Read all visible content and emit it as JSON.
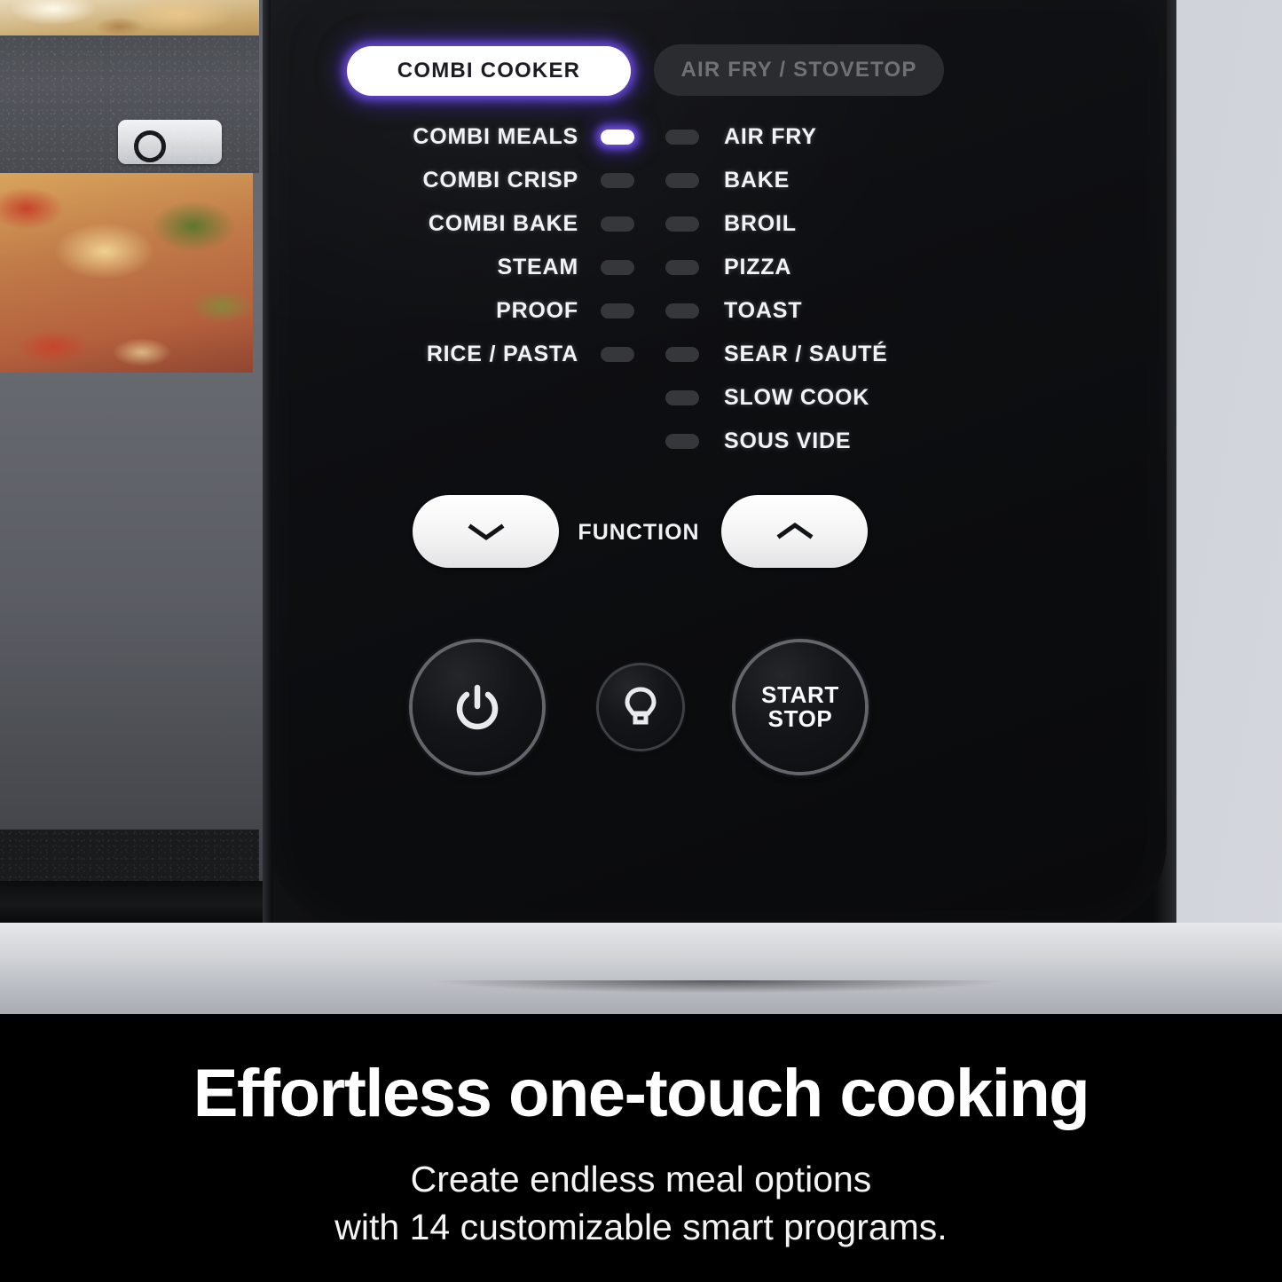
{
  "product_panel": {
    "mode_tabs": [
      {
        "label": "COMBI COOKER",
        "state": "selected"
      },
      {
        "label": "AIR FRY / STOVETOP",
        "state": "unselected"
      }
    ],
    "combi_functions": [
      {
        "label": "COMBI MEALS",
        "led": "on"
      },
      {
        "label": "COMBI CRISP",
        "led": "off"
      },
      {
        "label": "COMBI BAKE",
        "led": "off"
      },
      {
        "label": "STEAM",
        "led": "off"
      },
      {
        "label": "PROOF",
        "led": "off"
      },
      {
        "label": "RICE / PASTA",
        "led": "off"
      }
    ],
    "airfry_functions": [
      {
        "label": "AIR FRY",
        "led": "off"
      },
      {
        "label": "BAKE",
        "led": "off"
      },
      {
        "label": "BROIL",
        "led": "off"
      },
      {
        "label": "PIZZA",
        "led": "off"
      },
      {
        "label": "TOAST",
        "led": "off"
      },
      {
        "label": "SEAR / SAUTÉ",
        "led": "off"
      },
      {
        "label": "SLOW COOK",
        "led": "off"
      },
      {
        "label": "SOUS VIDE",
        "led": "off"
      }
    ],
    "function_control": {
      "label": "FUNCTION",
      "down_icon": "chevron-down-icon",
      "up_icon": "chevron-up-icon"
    },
    "buttons": {
      "power_icon": "power-icon",
      "light_icon": "light-bulb-icon",
      "start_stop_line1": "START",
      "start_stop_line2": "STOP"
    },
    "colors": {
      "accent_glow": "#6e4ee6",
      "panel_black": "#0b0c0e",
      "led_off": "#36373b",
      "led_on": "#ffffff",
      "background": "#c9cdd6"
    }
  },
  "caption": {
    "headline": "Effortless one-touch cooking",
    "subtitle_line1": "Create endless meal options",
    "subtitle_line2": "with 14 customizable smart programs."
  }
}
